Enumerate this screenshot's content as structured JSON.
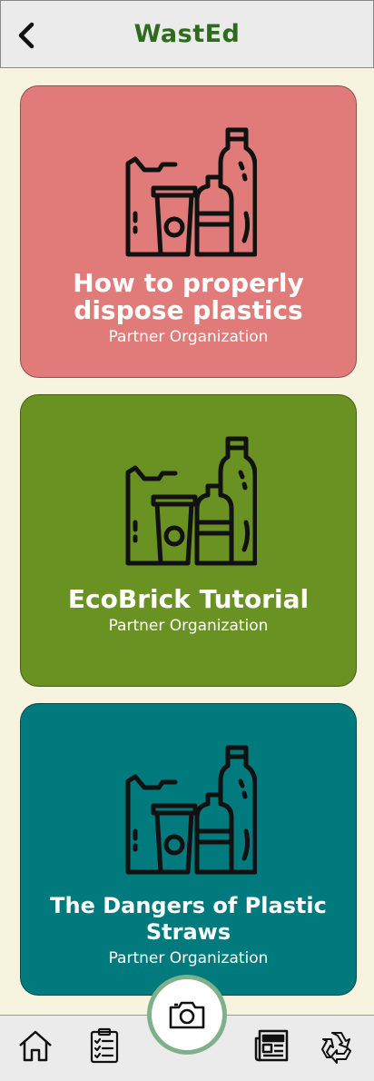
{
  "header": {
    "title": "WastEd"
  },
  "icons": {
    "back": "back-arrow-icon",
    "plastics": "plastic-waste-icon",
    "camera": "camera-icon",
    "home": "home-icon",
    "checklist": "clipboard-checklist-icon",
    "news": "newspaper-icon",
    "recycle": "recycle-icon"
  },
  "cards": [
    {
      "title": "How to properly dispose plastics",
      "subtitle": "Partner Organization",
      "color": "#e07b7a"
    },
    {
      "title": "EcoBrick Tutorial",
      "subtitle": "Partner Organization",
      "color": "#6a9222"
    },
    {
      "title": "The Dangers of Plastic Straws",
      "subtitle": "Partner Organization",
      "color": "#007a7c"
    }
  ],
  "colors": {
    "title": "#2f6b1e",
    "background": "#f6f3df",
    "camera_ring": "#7fb08a"
  }
}
